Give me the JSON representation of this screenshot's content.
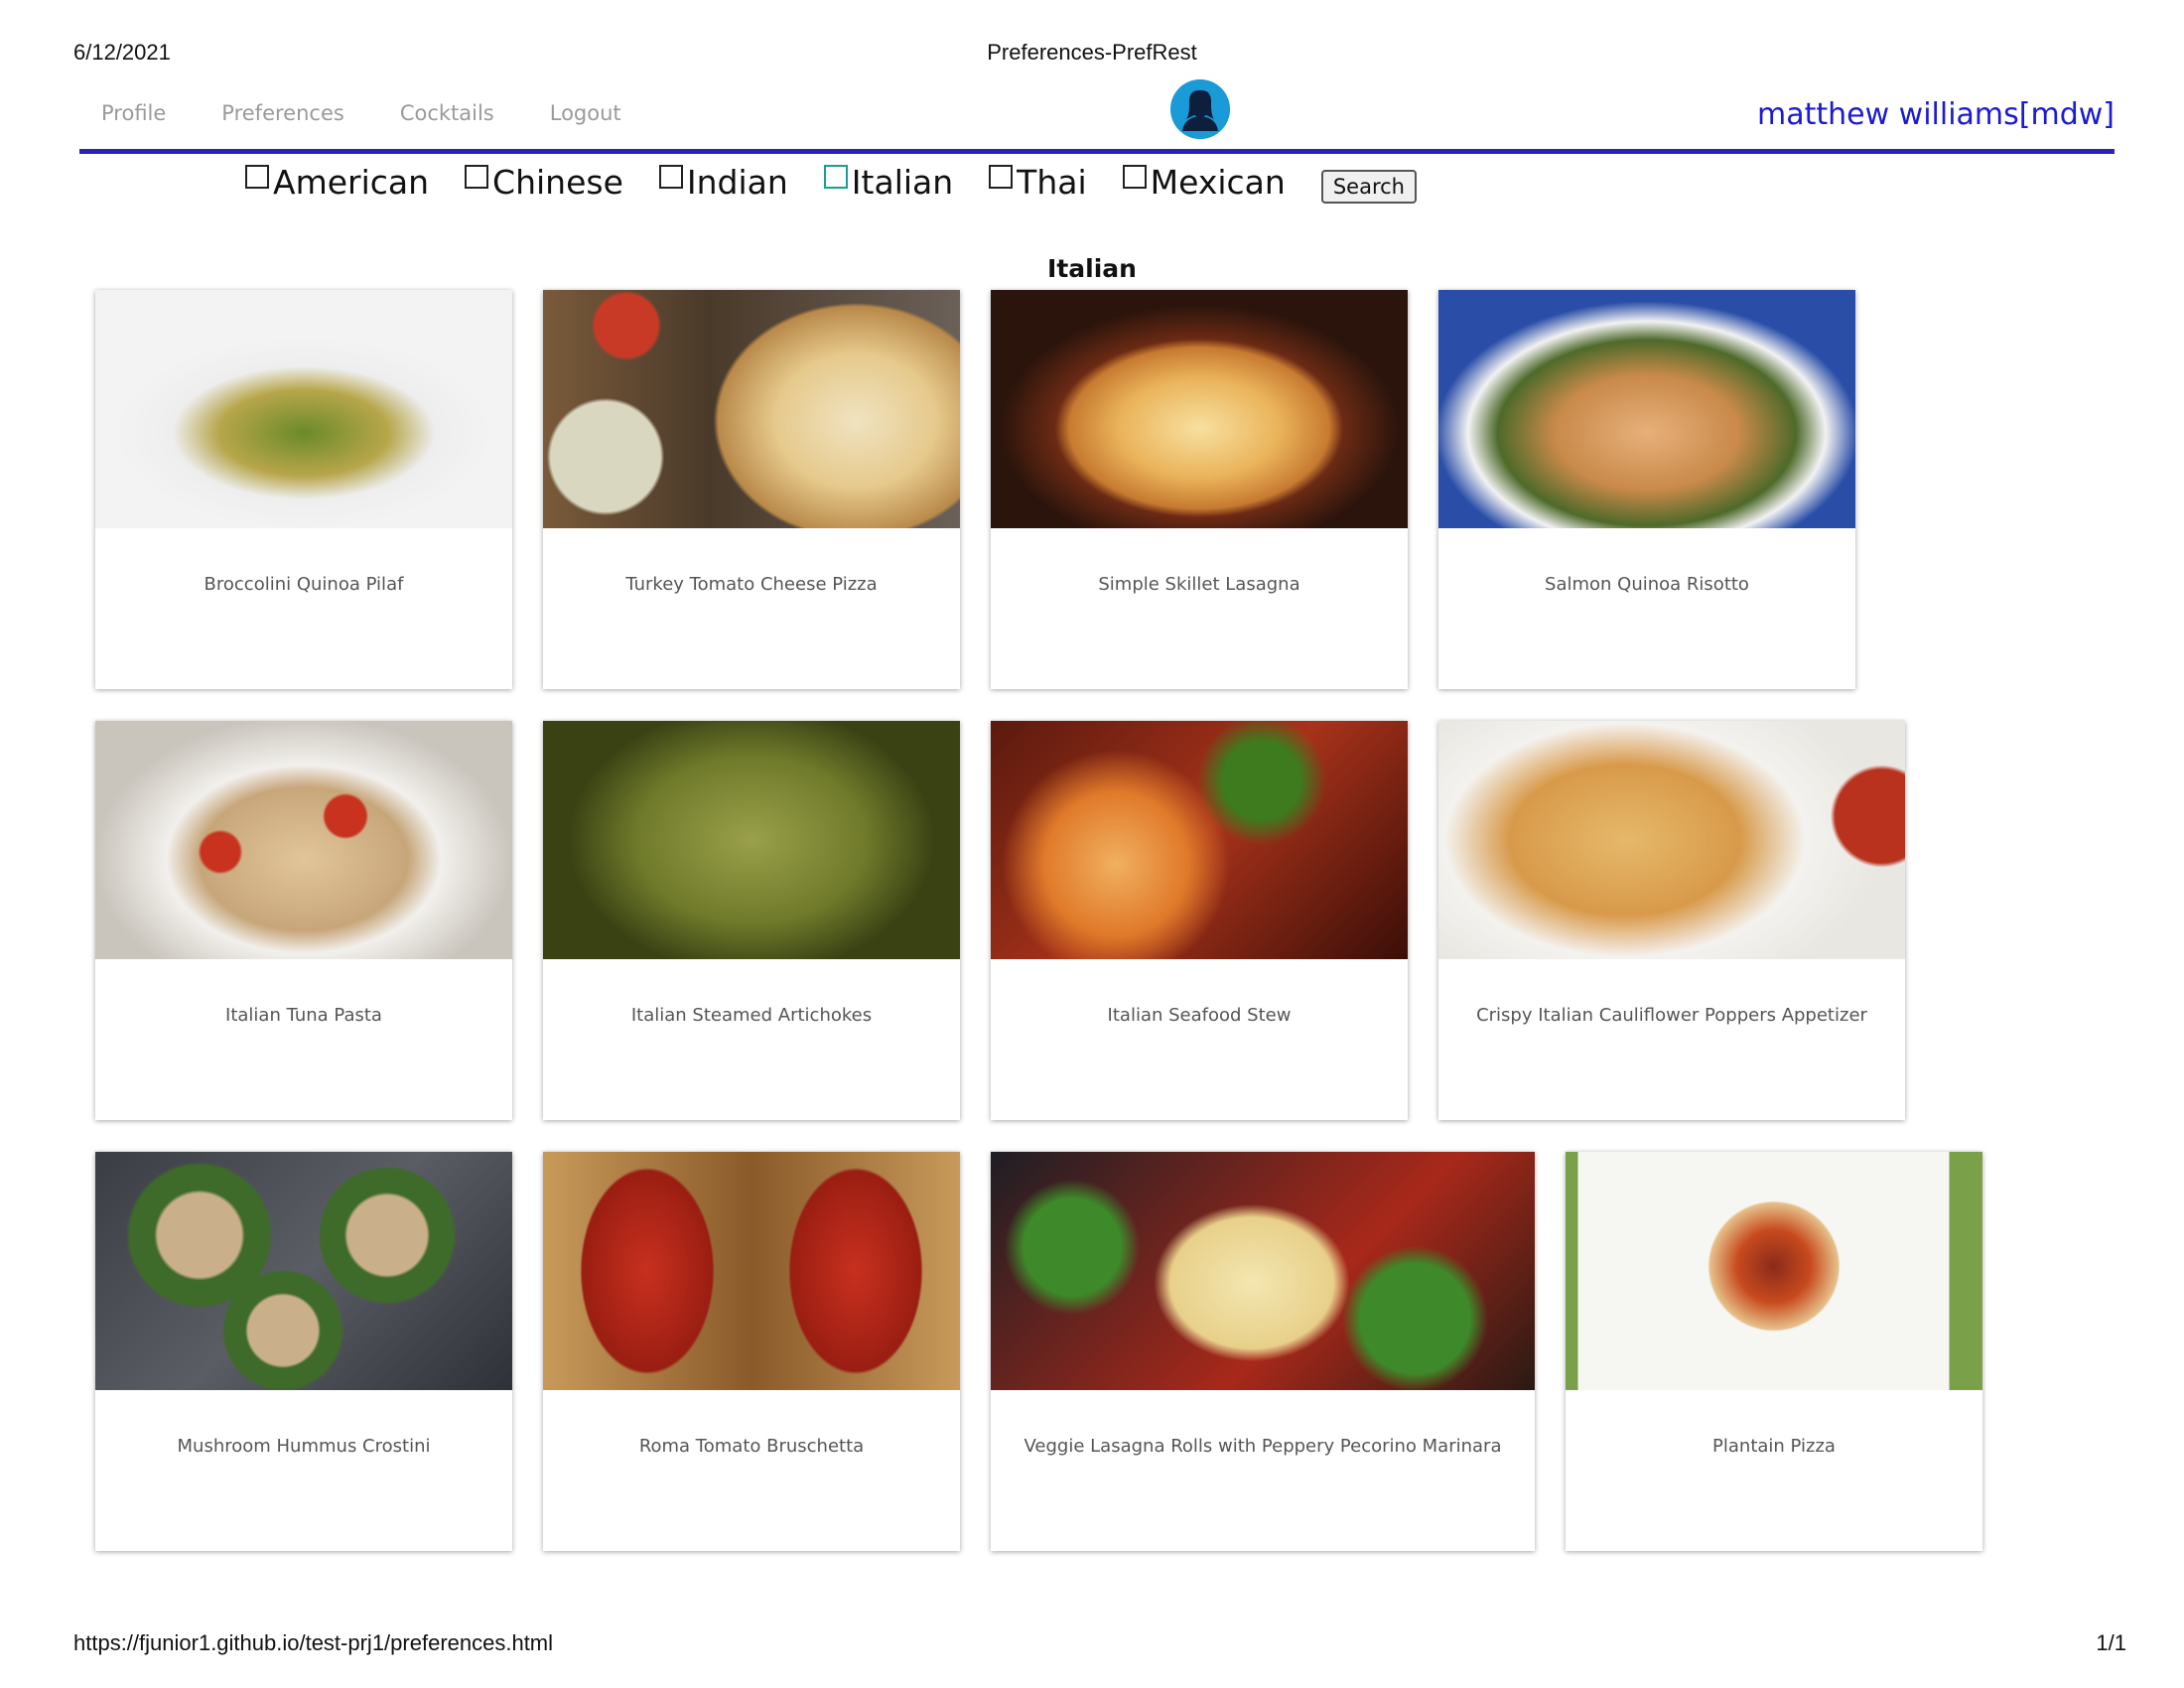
{
  "print_header": {
    "date": "6/12/2021",
    "title": "Preferences-PrefRest"
  },
  "print_footer": {
    "url": "https://fjunior1.github.io/test-prj1/preferences.html",
    "page": "1/1"
  },
  "nav": {
    "links": [
      "Profile",
      "Preferences",
      "Cocktails",
      "Logout"
    ],
    "user": "matthew williams[mdw]",
    "avatar_icon": "user-silhouette-icon"
  },
  "filters": {
    "options": [
      "American",
      "Chinese",
      "Indian",
      "Italian",
      "Thai",
      "Mexican"
    ],
    "checked": [
      false,
      false,
      false,
      false,
      false,
      false
    ],
    "search_label": "Search"
  },
  "section": {
    "title": "Italian"
  },
  "recipes": [
    {
      "title": "Broccolini Quinoa Pilaf"
    },
    {
      "title": "Turkey Tomato Cheese Pizza"
    },
    {
      "title": "Simple Skillet Lasagna"
    },
    {
      "title": "Salmon Quinoa Risotto"
    },
    {
      "title": "Italian Tuna Pasta"
    },
    {
      "title": "Italian Steamed Artichokes"
    },
    {
      "title": "Italian Seafood Stew"
    },
    {
      "title": "Crispy Italian Cauliflower Poppers Appetizer"
    },
    {
      "title": "Mushroom Hummus Crostini"
    },
    {
      "title": "Roma Tomato Bruschetta"
    },
    {
      "title": "Veggie Lasagna Rolls with Peppery Pecorino Marinara"
    },
    {
      "title": "Plantain Pizza"
    }
  ],
  "colors": {
    "accent": "#2d22b8",
    "user_link": "#1b1bcf",
    "avatar_bg": "#1a9bd7"
  }
}
